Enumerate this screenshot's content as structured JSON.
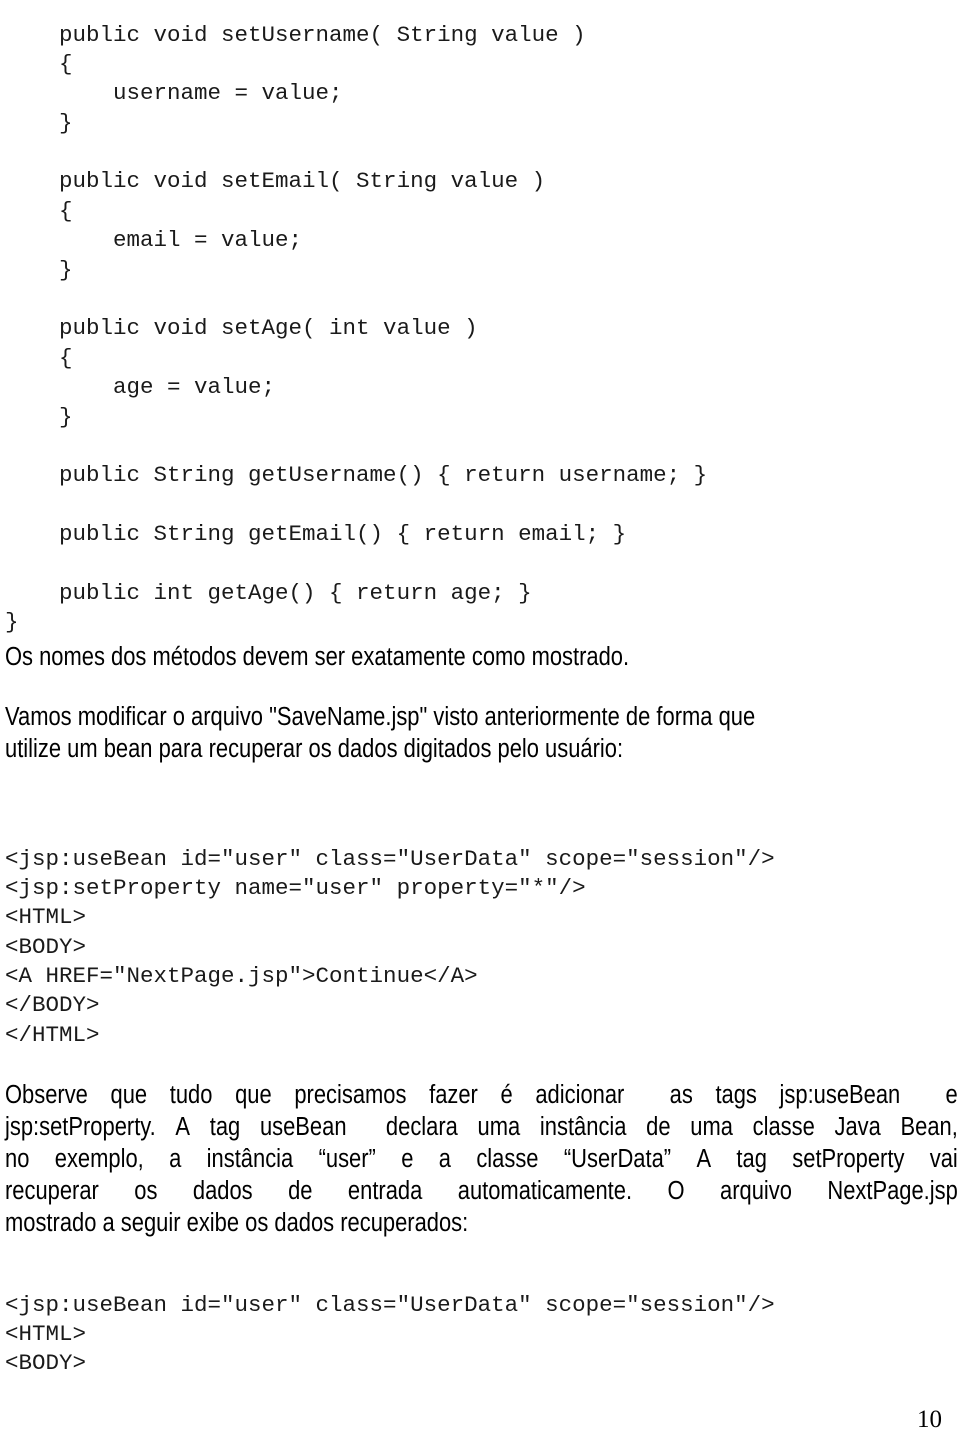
{
  "document": {
    "page_number": "10",
    "language": "pt-BR"
  },
  "code_block_methods": {
    "name": "UserData setter/getter methods",
    "lines": [
      "    public void setUsername( String value )",
      "    {",
      "        username = value;",
      "    }",
      "",
      "    public void setEmail( String value )",
      "    {",
      "        email = value;",
      "    }",
      "",
      "    public void setAge( int value )",
      "    {",
      "        age = value;",
      "    }",
      "",
      "    public String getUsername() { return username; }",
      "",
      "    public String getEmail() { return email; }",
      "",
      "    public int getAge() { return age; }",
      "}"
    ]
  },
  "note_methods": {
    "text": "Os nomes dos métodos devem ser exatamente como mostrado."
  },
  "intro_savename": {
    "line1": "Vamos modificar o arquivo \"SaveName.jsp\"  visto anteriormente de forma que",
    "line2": "utilize um bean para recuperar os dados digitados pelo usuário:"
  },
  "code_block_savename": {
    "name": "SaveName.jsp source",
    "lines": [
      "<jsp:useBean id=\"user\" class=\"UserData\" scope=\"session\"/>",
      "<jsp:setProperty name=\"user\" property=\"*\"/>",
      "<HTML>",
      "<BODY>",
      "<A HREF=\"NextPage.jsp\">Continue</A>",
      "</BODY>",
      "</HTML>"
    ]
  },
  "explanation": {
    "line1": {
      "words": [
        "Observe",
        "que",
        "tudo",
        "que",
        "precisamos",
        "fazer",
        "é",
        "adicionar",
        "",
        "as",
        "tags",
        "jsp:useBean",
        "",
        "e"
      ]
    },
    "line2": {
      "words": [
        "jsp:setProperty.",
        "A",
        "tag",
        "useBean",
        "",
        "declara",
        "uma",
        "instância",
        "de",
        "uma",
        "classe",
        "Java",
        "Bean,"
      ]
    },
    "line3": {
      "words": [
        "no",
        "exemplo,",
        "a",
        "instância",
        "“user”",
        "e",
        "a",
        "classe",
        "“UserData”",
        "A",
        "tag",
        "setProperty",
        "vai"
      ]
    },
    "line4": {
      "words": [
        "recuperar",
        "os",
        "dados",
        "de",
        "entrada",
        "automaticamente.",
        "O",
        "arquivo",
        "NextPage.jsp"
      ]
    },
    "line5": {
      "text": "mostrado a seguir exibe os dados recuperados:"
    }
  },
  "code_block_nextpage": {
    "name": "NextPage.jsp source",
    "lines": [
      "<jsp:useBean id=\"user\" class=\"UserData\" scope=\"session\"/>",
      "<HTML>",
      "<BODY>"
    ]
  }
}
